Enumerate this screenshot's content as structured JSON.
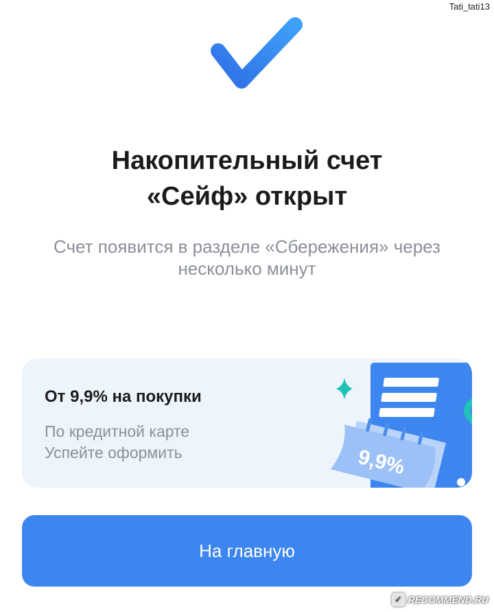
{
  "watermark_user": "Tati_tati13",
  "icons": {
    "success": "check-icon",
    "sparkle": "sparkle-icon",
    "calendar": "calendar-icon"
  },
  "colors": {
    "accent": "#3d86ef",
    "card_background": "#eef4fc",
    "title": "#1b1b1b",
    "muted_text": "#8b8f99"
  },
  "result": {
    "title_line1": "Накопительный счет",
    "title_line2": "«Сейф» открыт",
    "subtitle_line1": "Счет появится в разделе «Сбережения» через",
    "subtitle_line2": "несколько минут"
  },
  "promo": {
    "title": "От 9,9% на покупки",
    "line1": "По кредитной карте",
    "line2": "Успейте оформить",
    "badge": "9,9%"
  },
  "home_button": {
    "label": "На главную"
  },
  "watermark_site": "RECOMMEND.RU"
}
